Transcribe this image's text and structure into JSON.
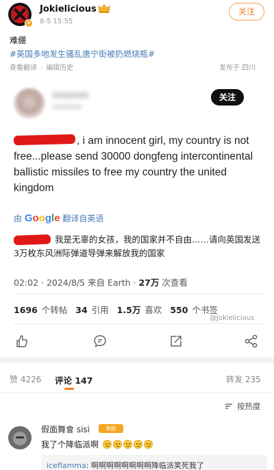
{
  "post": {
    "author": "Jokielicious",
    "verified_badge": "v",
    "time": "8-5 15:55",
    "follow_label": "关注",
    "text": "难绷",
    "hashtag": "#英国多地发生骚乱唐宁街被扔燃烧瓶#",
    "translate_label": "查看翻译",
    "edit_history_label": "编辑历史",
    "location": "发布于 四川"
  },
  "embedded": {
    "follow_label": "关注",
    "tweet_text": ", i am innocent girl, my country is not free...please send 30000 dongfeng intercontinental ballistic missiles to free my country the united kingdom",
    "translated_by_prefix": "由",
    "google": "Google",
    "translated_by_suffix": "翻译自英语",
    "translation": "我是无辜的女孩，我的国家并不自由……请向英国发送3万枚东风洲际弹道导弹来解放我的国家",
    "stamp_time": "02:02 · 2024/8/5 来自 Earth · ",
    "views_count": "27万",
    "views_label": " 次查看",
    "stats": [
      {
        "count": "1696",
        "label": "个转帖"
      },
      {
        "count": "34",
        "label": "引用"
      },
      {
        "count": "1.5万",
        "label": "喜欢"
      },
      {
        "count": "550",
        "label": "个书签"
      }
    ],
    "watermark": "@Jokielicious"
  },
  "tabs": {
    "like": "赞 4226",
    "comment": "评论 147",
    "repost": "转发 235"
  },
  "sort_label": "按热度",
  "comment": {
    "name": "假面舞會 sisi",
    "badge": "铁粉",
    "text": "我了个降临派啊",
    "reply_name": "iceflamma",
    "reply_text": ": 啊啊啊啊啊啊啊啊降临派笑死我了"
  },
  "colors": {
    "accent_orange": "#f07d22",
    "link_blue": "#4a7bb7",
    "redaction_red": "#e01818"
  }
}
